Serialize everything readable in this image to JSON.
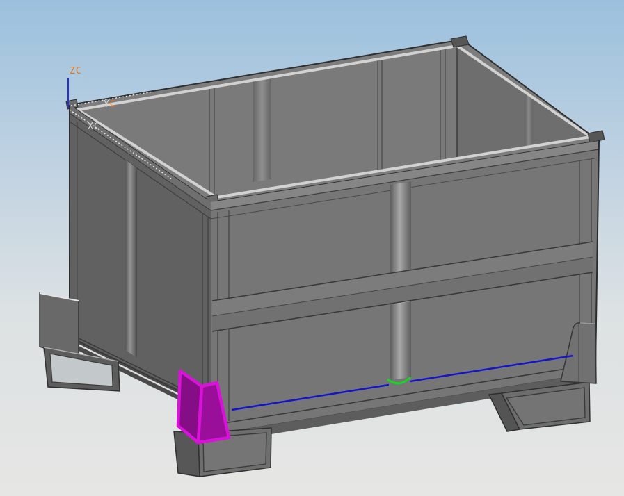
{
  "viewport": {
    "description": "shaded 3D CAD view of a steel pallet container with open top",
    "background_top": "#9bc0dd",
    "background_bottom": "#e6e6e4",
    "wcs": {
      "z_label": "ZC",
      "x_label": "XC",
      "y_label_part1": "Y",
      "y_label_part2": "C",
      "label_orange": "#e0731c",
      "label_gray": "#d6d6d6",
      "z_axis_blue": "#2a2ad8",
      "axis_dotted": "#ececec"
    },
    "model": {
      "part_name": "pallet-container",
      "face_gray_front": "#767676",
      "face_gray_left": "#616161",
      "interior_left": "#7a7a7a",
      "interior_right": "#6e6e6e",
      "rim_band": "#7d7d7d",
      "edge_dark": "#2e2e2e",
      "lip_light": "#d2d2d2"
    },
    "selection": {
      "edge_blue": "#1414cd",
      "arc_green": "#17d620",
      "bracket_outline_magenta": "#d912d9",
      "bracket_face_dark": "#850d85",
      "bracket_face_light": "#9a0f9a"
    }
  }
}
